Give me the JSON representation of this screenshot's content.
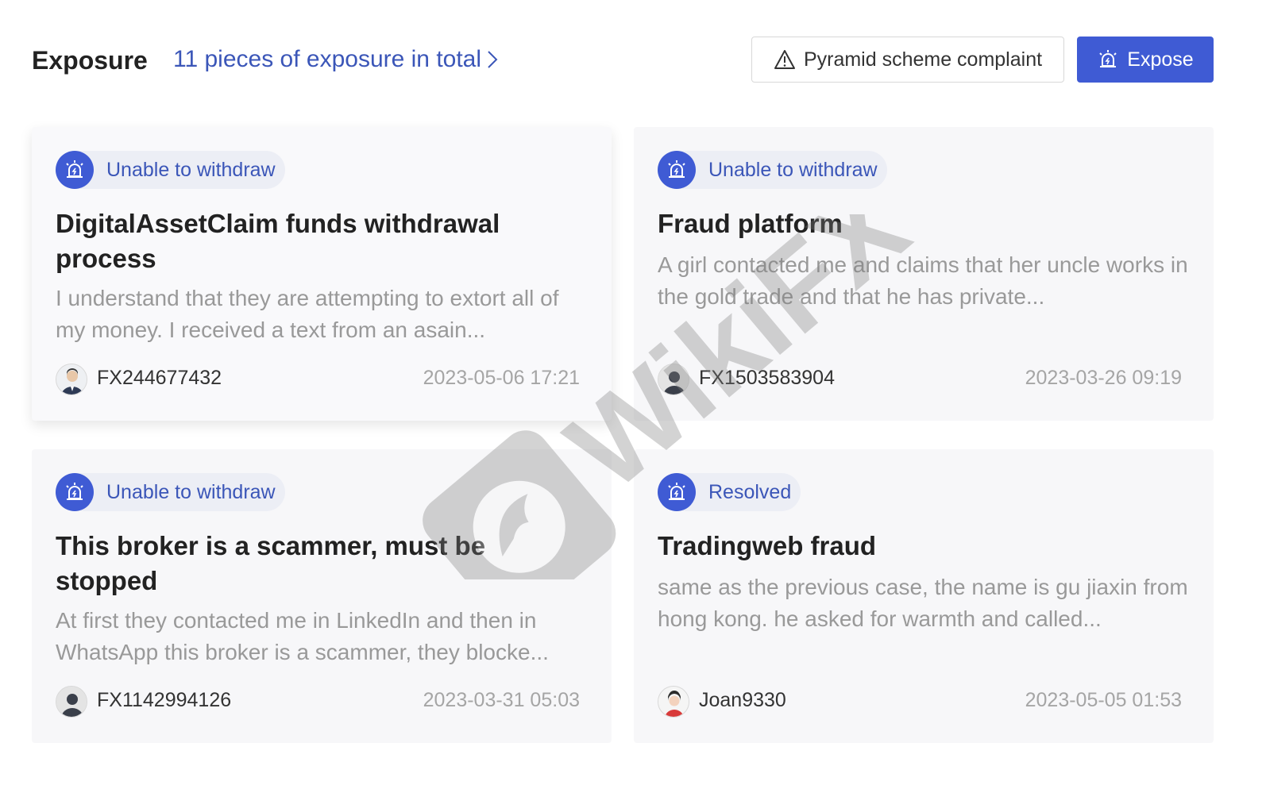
{
  "header": {
    "title": "Exposure",
    "total_link": "11 pieces of exposure in total",
    "complaint_button": "Pyramid scheme complaint",
    "expose_button": "Expose"
  },
  "colors": {
    "accent": "#3f5bd4",
    "link": "#3b56b8",
    "tag_bg": "#eceef5"
  },
  "cards": [
    {
      "tag": "Unable to withdraw",
      "title": "DigitalAssetClaim funds withdrawal process",
      "text": "I understand that they are attempting to extort all of my money. I received a text from an asain...",
      "user": "FX244677432",
      "date": "2023-05-06 17:21"
    },
    {
      "tag": "Unable to withdraw",
      "title": "Fraud platform",
      "text": "A girl contacted me and claims that her uncle works in the gold trade and that he has private...",
      "user": "FX1503583904",
      "date": "2023-03-26 09:19"
    },
    {
      "tag": "Unable to withdraw",
      "title": "This broker is a scammer, must be stopped",
      "text": "At first they contacted me in LinkedIn and then in WhatsApp this broker is a scammer, they blocke...",
      "user": "FX1142994126",
      "date": "2023-03-31 05:03"
    },
    {
      "tag": "Resolved",
      "title": "Tradingweb fraud",
      "text": "same as the previous case, the name is gu jiaxin from hong kong. he asked for warmth and called...",
      "user": "Joan9330",
      "date": "2023-05-05 01:53"
    }
  ],
  "watermark": {
    "text": "WikiFX"
  }
}
